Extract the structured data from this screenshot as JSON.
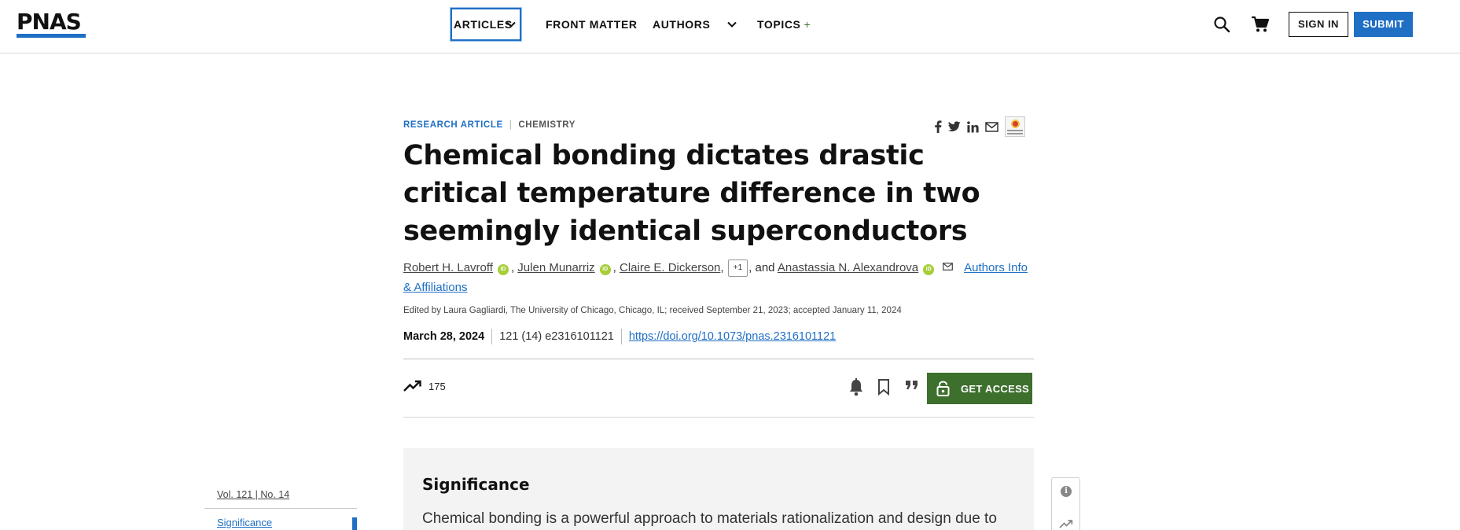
{
  "header": {
    "logo": "PNAS",
    "nav": [
      {
        "label": "ARTICLES"
      },
      {
        "label": "FRONT MATTER"
      },
      {
        "label": "AUTHORS"
      },
      {
        "label": "TOPICS"
      }
    ],
    "topics_plus": "+",
    "sign_in": "SIGN IN",
    "submit": "SUBMIT"
  },
  "article": {
    "type": "RESEARCH ARTICLE",
    "subject": "CHEMISTRY",
    "title": "Chemical bonding dictates drastic critical temperature difference in two seemingly identical superconductors",
    "authors": [
      {
        "name": "Robert H. Lavroff"
      },
      {
        "name": "Julen Munarriz"
      },
      {
        "name": "Claire E. Dickerson"
      },
      {
        "name": "Anastassia N. Alexandrova"
      }
    ],
    "more_authors": "+1",
    "and_text": "and",
    "authors_info": "Authors Info & Affiliations",
    "edited_by": "Edited by Laura Gagliardi, The University of Chicago, Chicago, IL; received September 21, 2023; accepted January 11, 2024",
    "date": "March 28, 2024",
    "citation": "121 (14) e2316101121",
    "doi": "https://doi.org/10.1073/pnas.2316101121",
    "metric_count": "175",
    "get_access": "GET ACCESS"
  },
  "significance": {
    "title": "Significance",
    "text": "Chemical bonding is a powerful approach to materials rationalization and design due to"
  },
  "toc": {
    "volume": "Vol. 121 | No. 14",
    "items": [
      {
        "label": "Significance"
      }
    ]
  },
  "icons": {
    "share": [
      "facebook-icon",
      "twitter-icon",
      "linkedin-icon",
      "email-icon",
      "crossmark-icon"
    ],
    "actions": [
      "bell-icon",
      "bookmark-icon",
      "quote-icon",
      "lock-icon"
    ],
    "side": [
      "info-icon",
      "trending-icon"
    ]
  },
  "colors": {
    "brand_blue": "#1f6fc5",
    "access_green": "#3d6f2d",
    "orcid_green": "#a6ce39",
    "panel_gray": "#f3f3f3"
  }
}
